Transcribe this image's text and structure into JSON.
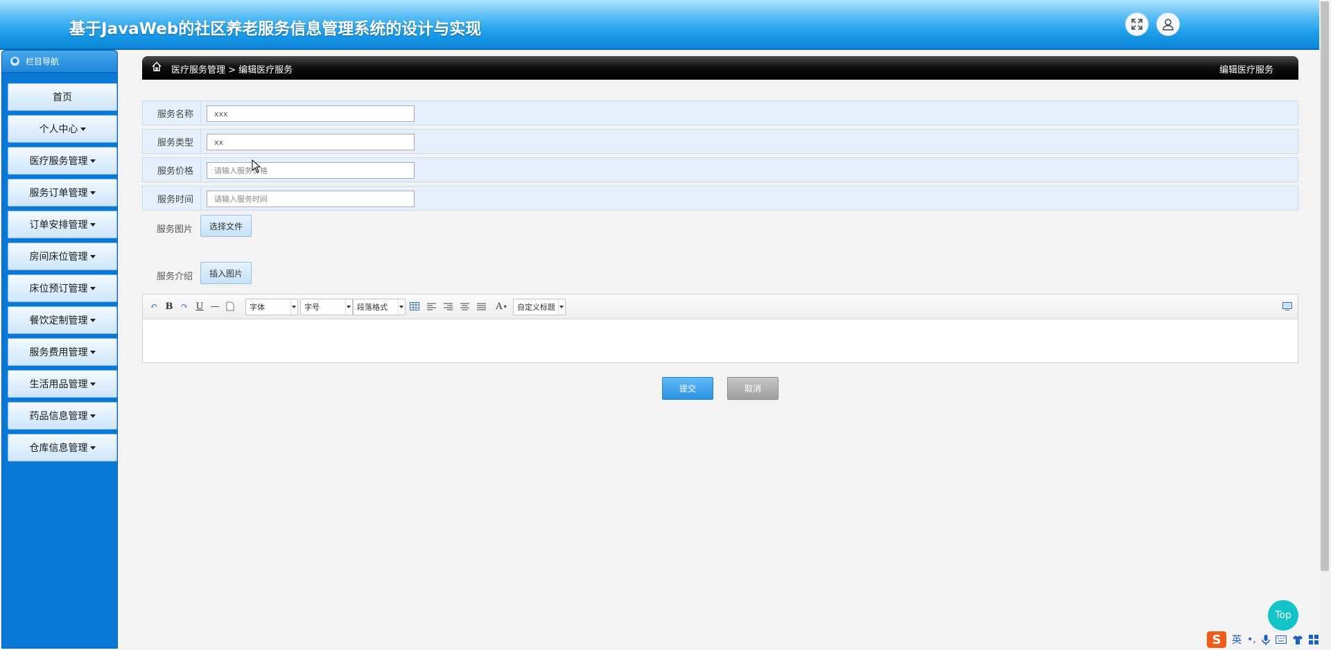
{
  "header": {
    "title": "基于JavaWeb的社区养老服务信息管理系统的设计与实现"
  },
  "sidebar": {
    "title": "栏目导航",
    "items": [
      {
        "label": "首页",
        "dropdown": false
      },
      {
        "label": "个人中心",
        "dropdown": true
      },
      {
        "label": "医疗服务管理",
        "dropdown": true
      },
      {
        "label": "服务订单管理",
        "dropdown": true
      },
      {
        "label": "订单安排管理",
        "dropdown": true
      },
      {
        "label": "房间床位管理",
        "dropdown": true
      },
      {
        "label": "床位预订管理",
        "dropdown": true
      },
      {
        "label": "餐饮定制管理",
        "dropdown": true
      },
      {
        "label": "服务费用管理",
        "dropdown": true
      },
      {
        "label": "生活用品管理",
        "dropdown": true
      },
      {
        "label": "药品信息管理",
        "dropdown": true
      },
      {
        "label": "仓库信息管理",
        "dropdown": true
      }
    ]
  },
  "breadcrumb": {
    "path": "医疗服务管理 > 编辑医疗服务",
    "page_title": "编辑医疗服务"
  },
  "form": {
    "name": {
      "label": "服务名称",
      "value": "xxx",
      "placeholder": ""
    },
    "type": {
      "label": "服务类型",
      "value": "xx",
      "placeholder": ""
    },
    "price": {
      "label": "服务价格",
      "value": "",
      "placeholder": "请输入服务价格"
    },
    "time": {
      "label": "服务时间",
      "value": "",
      "placeholder": "请输入服务时间"
    },
    "image": {
      "label": "服务图片",
      "button": "选择文件"
    },
    "intro": {
      "label": "服务介绍",
      "button": "插入图片"
    }
  },
  "editor": {
    "font_select": "字体",
    "size_select": "字号",
    "format_select": "段落格式",
    "custom_select": "自定义标题"
  },
  "actions": {
    "submit": "提交",
    "cancel": "取消"
  },
  "top_button": "Top",
  "ime": {
    "logo": "S",
    "lang": "英"
  },
  "colors": {
    "header_blue": "#1a9be8",
    "sidebar_blue": "#0a78d6",
    "submit_blue": "#2b93e3",
    "top_teal": "#12c3c8"
  }
}
